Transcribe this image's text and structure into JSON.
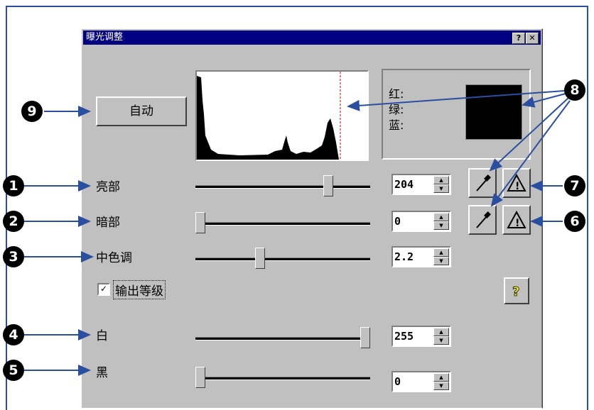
{
  "dialog": {
    "title": "曝光调整",
    "help_btn": "?",
    "close_btn": "✕"
  },
  "auto_button": "自动",
  "rgb": {
    "red": "红:",
    "green": "绿:",
    "blue": "蓝:",
    "color_hex": "#000000"
  },
  "rows": {
    "highlight": {
      "label": "亮部",
      "value": "204",
      "level": 204
    },
    "shadow": {
      "label": "暗部",
      "value": "0",
      "level": 0
    },
    "midtone": {
      "label": "中色调",
      "value": "2.2",
      "level": 0.42
    },
    "white": {
      "label": "白",
      "value": "255",
      "level": 255
    },
    "black": {
      "label": "黑",
      "value": "0",
      "level": 0
    }
  },
  "output_levels": {
    "label": "输出等级",
    "checked": true
  },
  "help_icon": "?",
  "callouts": [
    "1",
    "2",
    "3",
    "4",
    "5",
    "6",
    "7",
    "8",
    "9"
  ],
  "icons": [
    "eyedropper-icon",
    "warning-icon",
    "help-icon"
  ],
  "colors": {
    "accent": "#2a4fa0",
    "titlebar": "#000080",
    "dialog_bg": "#c0c0c0"
  }
}
